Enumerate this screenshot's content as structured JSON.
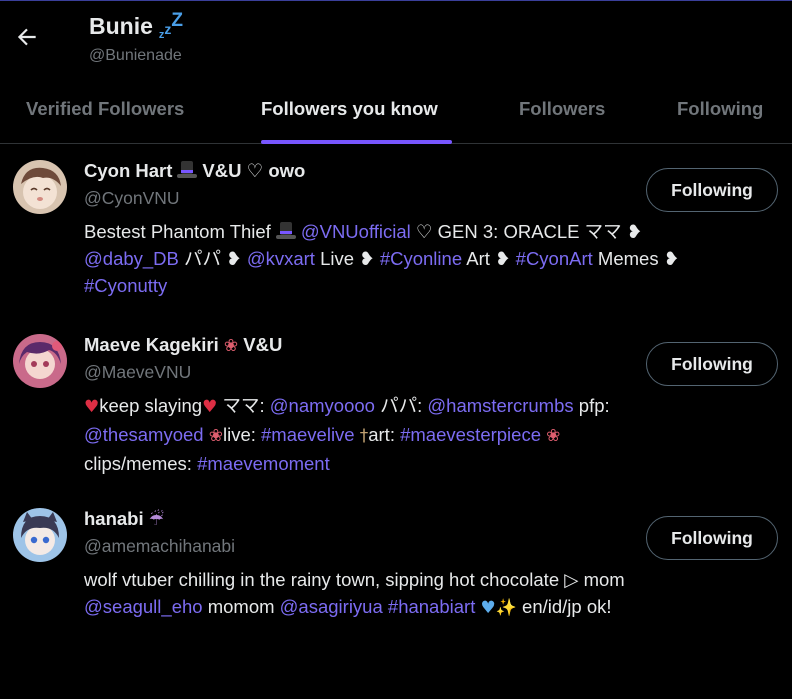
{
  "header": {
    "title": "Bunie",
    "zzz": [
      "z",
      "z",
      "Z"
    ],
    "handle": "@Bunienade"
  },
  "tabs": [
    {
      "label": "Verified Followers",
      "active": false
    },
    {
      "label": "Followers you know",
      "active": true
    },
    {
      "label": "Followers",
      "active": false
    },
    {
      "label": "Following",
      "active": false
    }
  ],
  "colors": {
    "accent": "#7856ff",
    "link": "#7c6cf2",
    "muted": "#71767b",
    "background": "#000000"
  },
  "users": [
    {
      "name_a": "Cyon Hart",
      "name_icon": "top-hat",
      "name_b": "V&U ♡ owo",
      "handle": "@CyonVNU",
      "button": "Following",
      "bio": {
        "l1_t1": "Bestest Phantom Thief",
        "l1_link1": "@VNUofficial",
        "l1_t2": "♡ GEN 3: ORACLE ママ ❥",
        "l2_link1": "@daby_DB",
        "l2_t1": "パパ ❥",
        "l2_link2": "@kvxart",
        "l2_t2": "Live ❥",
        "l2_link3": "#Cyonline",
        "l2_t3": "Art ❥",
        "l2_link4": "#CyonArt",
        "l2_t4": "Memes ❥",
        "l3_link1": "#Cyonutty"
      }
    },
    {
      "name_a": "Maeve Kagekiri",
      "name_icon": "tulip",
      "name_b": "V&U",
      "handle": "@MaeveVNU",
      "button": "Following",
      "bio": {
        "l1_t1": "keep slaying",
        "l1_t2": "ママ:",
        "l1_link1": "@namyoooo",
        "l1_t3": "パパ:",
        "l1_link2": "@hamstercrumbs",
        "l1_t4": "pfp:",
        "l2_link1": "@thesamyoed",
        "l2_t1": "live:",
        "l2_link2": "#maevelive",
        "l2_t2": "art:",
        "l2_link3": "#maevesterpiece",
        "l3_t1": "clips/memes:",
        "l3_link1": "#maevemoment"
      }
    },
    {
      "name_a": "hanabi",
      "name_icon": "umbrella",
      "handle": "@amemachihanabi",
      "button": "Following",
      "bio": {
        "l1_t1": "wolf vtuber chilling in the rainy town, sipping hot chocolate ▷ mom",
        "l2_link1": "@seagull_eho",
        "l2_t1": "momom",
        "l2_link2": "@asagiriyua",
        "l2_link3": "#hanabiart",
        "l2_t2": "en/id/jp ok!"
      }
    }
  ]
}
